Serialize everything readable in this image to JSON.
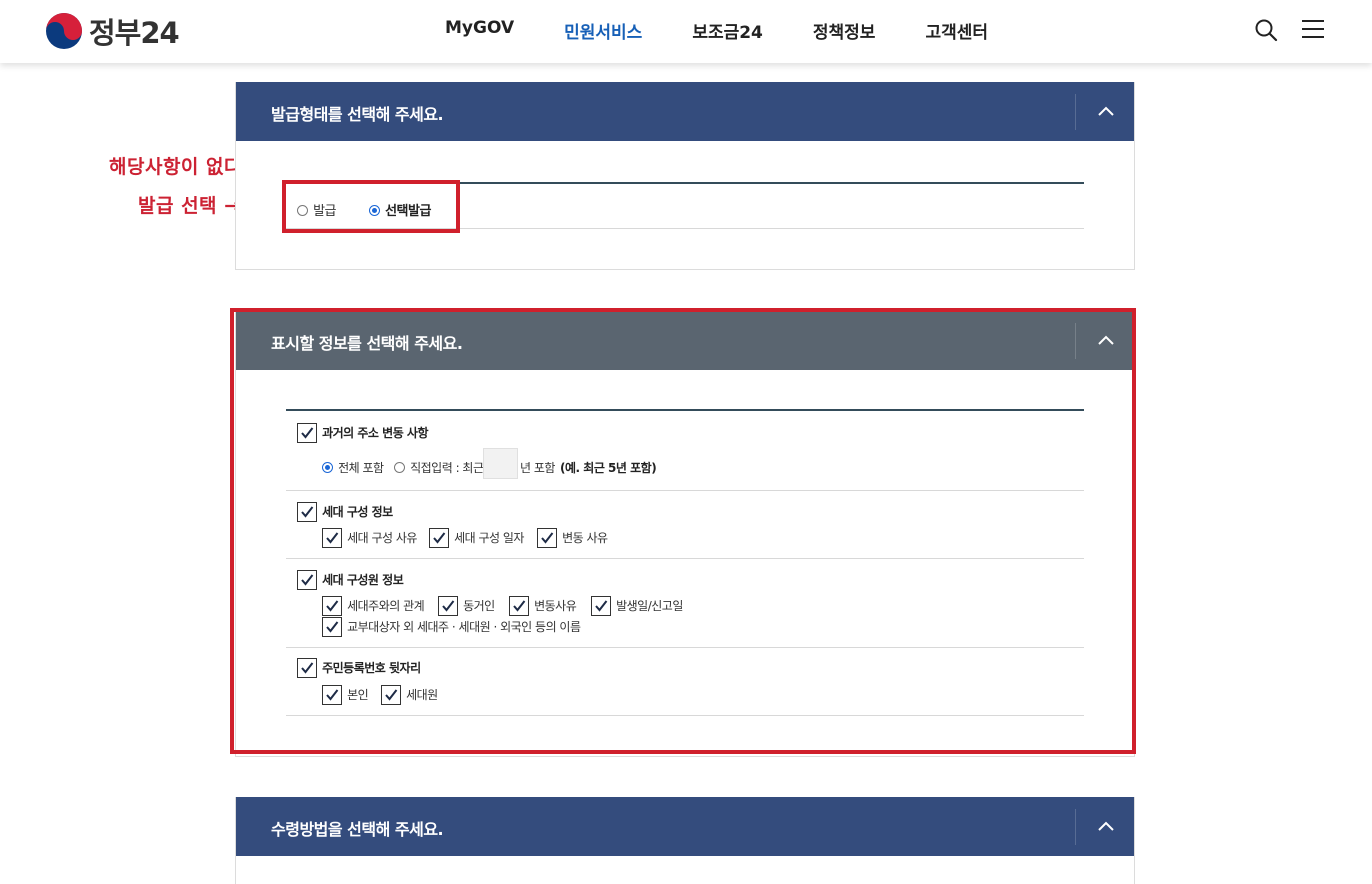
{
  "header": {
    "logo_text": "정부24",
    "nav": [
      "MyGOV",
      "민원서비스",
      "보조금24",
      "정책정보",
      "고객센터"
    ],
    "active_nav": "민원서비스"
  },
  "annotation": {
    "line1": "해당사항이 없다면",
    "line2": "발급 선택 →"
  },
  "section_issue": {
    "title": "발급형태를 선택해 주세요.",
    "options": [
      "발급",
      "선택발급"
    ],
    "selected": "선택발급"
  },
  "section_info": {
    "title": "표시할 정보를 선택해 주세요.",
    "groups": {
      "past_address": {
        "label": "과거의 주소 변동 사항",
        "checked": true,
        "radio_all": "전체 포함",
        "radio_direct": "직접입력 : 최근",
        "years_input_value": "",
        "years_suffix": "년 포함",
        "example": "(예. 최근 5년 포함)",
        "selected": "전체 포함"
      },
      "household": {
        "label": "세대 구성 정보",
        "checked": true,
        "items": [
          "세대 구성 사유",
          "세대 구성 일자",
          "변동 사유"
        ]
      },
      "members": {
        "label": "세대 구성원 정보",
        "checked": true,
        "items": [
          "세대주와의 관계",
          "동거인",
          "변동사유",
          "발생일/신고일"
        ],
        "extra": "교부대상자 외 세대주 · 세대원 · 외국인 등의 이름"
      },
      "rrn": {
        "label": "주민등록번호 뒷자리",
        "checked": true,
        "items": [
          "본인",
          "세대원"
        ]
      }
    }
  },
  "section_receive": {
    "title": "수령방법을 선택해 주세요."
  },
  "colors": {
    "panel_blue": "#344c7d",
    "panel_gray": "#5a6570",
    "accent": "#1760b7",
    "highlight": "#d0202c"
  }
}
